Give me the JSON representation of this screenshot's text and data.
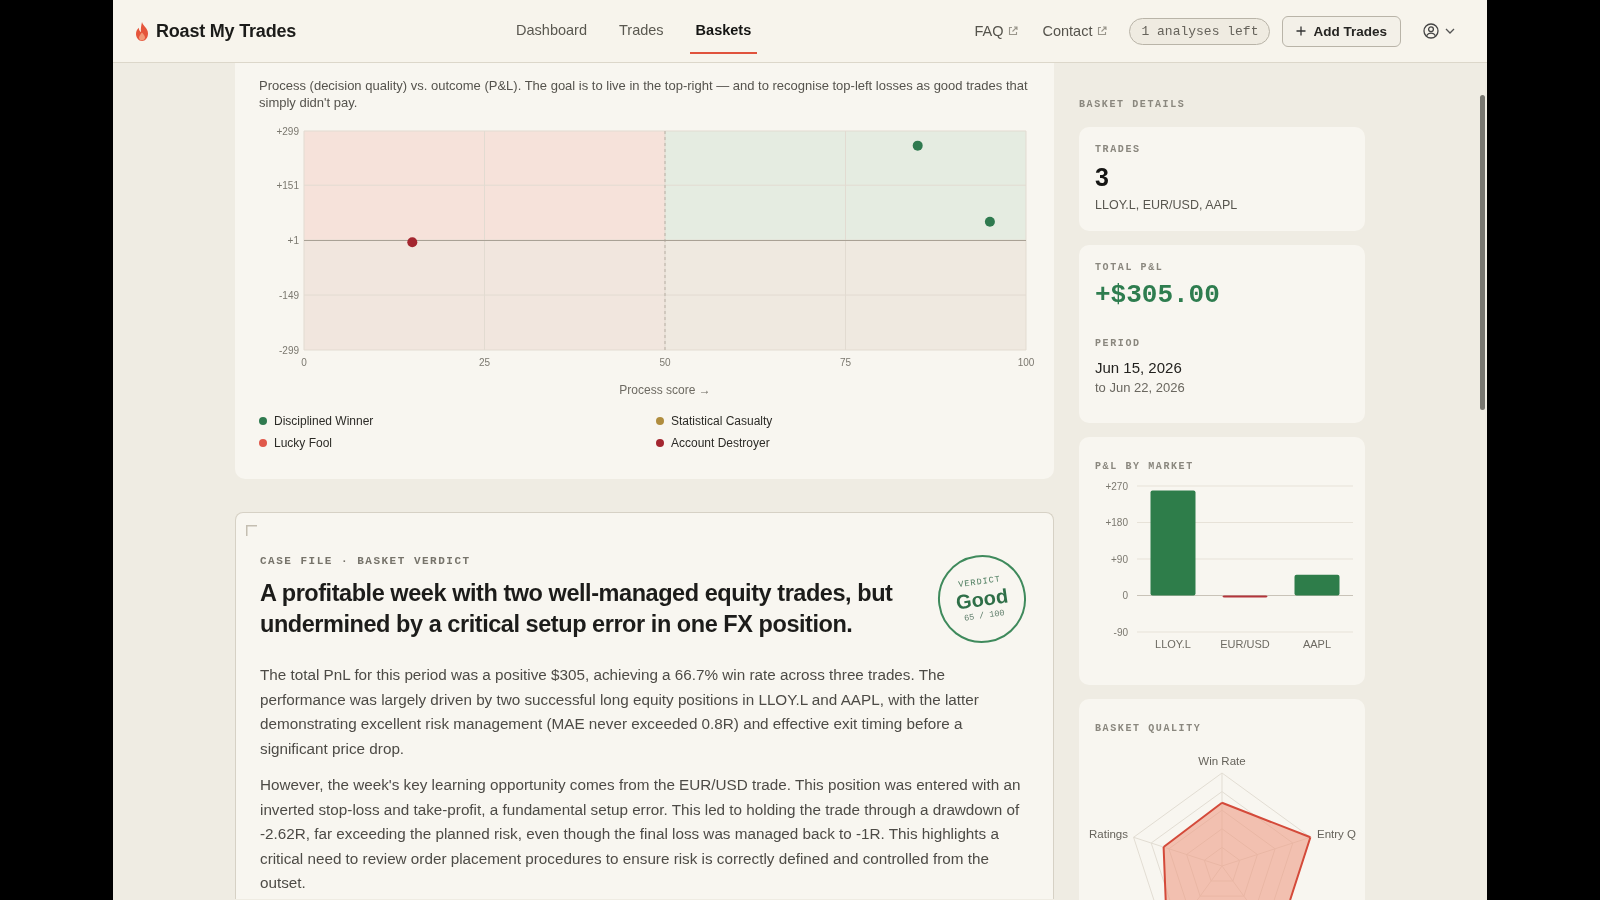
{
  "header": {
    "logo": "Roast My Trades",
    "nav": [
      {
        "label": "Dashboard",
        "selected": false
      },
      {
        "label": "Trades",
        "selected": false
      },
      {
        "label": "Baskets",
        "selected": true
      }
    ],
    "links": [
      {
        "label": "FAQ",
        "external": true
      },
      {
        "label": "Contact",
        "external": true
      }
    ],
    "credits": "1 analyses left",
    "add_button": "Add Trades"
  },
  "process_chart": {
    "description": "Process (decision quality) vs. outcome (P&L). The goal is to live in the top-right — and to recognise top-left losses as good trades that simply didn't pay.",
    "chart_data": {
      "type": "scatter",
      "xlabel": "Process score →",
      "xlim": [
        0,
        100
      ],
      "ylim": [
        -299,
        299
      ],
      "xticks": [
        0,
        25,
        50,
        75,
        100
      ],
      "yticks": [
        {
          "value": 299,
          "label": "+299"
        },
        {
          "value": 151,
          "label": "+151"
        },
        {
          "value": 1,
          "label": "+1"
        },
        {
          "value": -149,
          "label": "-149"
        },
        {
          "value": -299,
          "label": "-299"
        }
      ],
      "grid": true,
      "ref_lines": [
        {
          "axis": "x",
          "value": 50
        },
        {
          "axis": "y",
          "value": 0
        }
      ],
      "series": [
        {
          "name": "Disciplined Winner",
          "color": "#2f7a4f",
          "x": [
            85,
            95
          ],
          "values": [
            259,
            51
          ]
        },
        {
          "name": "Statistical Casualty",
          "color": "#b08d3e"
        },
        {
          "name": "Lucky Fool",
          "color": "#e0584a"
        },
        {
          "name": "Account Destroyer",
          "color": "#a3262f",
          "x": [
            15
          ],
          "values": [
            -5
          ]
        }
      ]
    }
  },
  "verdict": {
    "eyebrow": "CASE FILE · BASKET VERDICT",
    "headline": "A profitable week with two well-managed equity trades, but undermined by a critical setup error in one FX position.",
    "stamp": {
      "label": "VERDICT",
      "grade": "Good",
      "score": "65 / 100"
    },
    "paragraphs": [
      "The total PnL for this period was a positive $305, achieving a 66.7% win rate across three trades. The performance was largely driven by two successful long equity positions in LLOY.L and AAPL, with the latter demonstrating excellent risk management (MAE never exceeded 0.8R) and effective exit timing before a significant price drop.",
      "However, the week's key learning opportunity comes from the EUR/USD trade. This position was entered with an inverted stop-loss and take-profit, a fundamental setup error. This led to holding the trade through a drawdown of -2.62R, far exceeding the planned risk, even though the final loss was managed back to -1R. This highlights a critical need to review order placement procedures to ensure risk is correctly defined and controlled from the outset."
    ]
  },
  "sidebar": {
    "title": "BASKET DETAILS",
    "trades": {
      "label": "TRADES",
      "value": "3",
      "symbols": "LLOY.L, EUR/USD, AAPL"
    },
    "pnl": {
      "label": "TOTAL P&L",
      "value": "+$305.00",
      "positive": true,
      "period_label": "PERIOD",
      "start": "Jun 15, 2026",
      "end": "to Jun 22, 2026"
    },
    "market_chart": {
      "title": "P&L BY MARKET",
      "chart_data": {
        "type": "bar",
        "categories": [
          "LLOY.L",
          "EUR/USD",
          "AAPL"
        ],
        "ylim": [
          -90,
          270
        ],
        "yticks": [
          {
            "value": 270,
            "label": "+270"
          },
          {
            "value": 180,
            "label": "+180"
          },
          {
            "value": 90,
            "label": "+90"
          },
          {
            "value": 0,
            "label": "0"
          },
          {
            "value": -90,
            "label": "-90"
          }
        ],
        "grid": true,
        "series": [
          {
            "colors": [
              "#2e7d4a",
              "#b3353b",
              "#2e7d4a"
            ],
            "values": [
              259,
              -5,
              51
            ]
          }
        ]
      }
    },
    "quality": {
      "title": "BASKET QUALITY",
      "axes": [
        "Win Rate",
        "Entry Q",
        "Ratings"
      ]
    }
  }
}
